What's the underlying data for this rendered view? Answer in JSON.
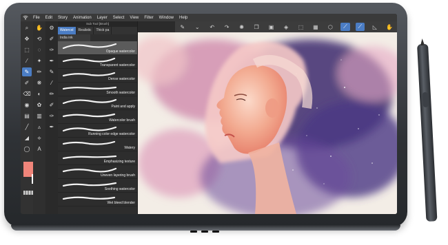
{
  "menu": {
    "items": [
      "File",
      "Edit",
      "Story",
      "Animation",
      "Layer",
      "Select",
      "View",
      "Filter",
      "Window",
      "Help"
    ]
  },
  "sub_tool": {
    "title": "Sub Tool [Brush]",
    "tabs": [
      "Watercol",
      "Realistic",
      "Thick pa"
    ],
    "active_tab": 0,
    "extra_tab": "India ink",
    "brushes": [
      {
        "label": "Opaque watercolor",
        "selected": true
      },
      {
        "label": "Transparent watercolor",
        "selected": false
      },
      {
        "label": "Dense watercolor",
        "selected": false
      },
      {
        "label": "Smooth watercolor",
        "selected": false
      },
      {
        "label": "Paint and apply",
        "selected": false
      },
      {
        "label": "Watercolor brush",
        "selected": false
      },
      {
        "label": "Running color edge watercolor",
        "selected": false
      },
      {
        "label": "Watery",
        "selected": false
      },
      {
        "label": "Emphasizing texture",
        "selected": false
      },
      {
        "label": "Uneven layering brush",
        "selected": false
      },
      {
        "label": "Soothing watercolor",
        "selected": false
      },
      {
        "label": "Wet bleed blender",
        "selected": false
      }
    ]
  },
  "colors": {
    "main": "#f0857a",
    "sub": "#ffffff",
    "accent": "#4b7dc4"
  },
  "icons": {
    "toolbar": [
      "pen-icon",
      "chevron-down-icon",
      "undo-icon",
      "redo-icon",
      "spin-icon",
      "copy-icon",
      "paste-icon",
      "fill-icon",
      "transform-icon",
      "clear-icon",
      "select-icon",
      "brush-stroke-icon",
      "line-icon",
      "ruler-icon",
      "hand-icon"
    ],
    "tools_left": [
      "zoom-icon",
      "move-icon",
      "select-rect-icon",
      "eyedropper-icon",
      "pen-tool-icon",
      "brush-tool-icon",
      "eraser-icon",
      "fill-tool-icon",
      "gradient-icon",
      "figure-icon",
      "text-icon",
      "balloon-icon"
    ],
    "tools_right": [
      "hand-tool-icon",
      "rotate-icon",
      "lasso-icon",
      "magic-wand-icon",
      "pencil-icon",
      "airbrush-icon",
      "blend-icon",
      "decoration-icon",
      "frame-icon",
      "ruler-tool-icon",
      "correction-icon",
      "3d-icon"
    ]
  }
}
